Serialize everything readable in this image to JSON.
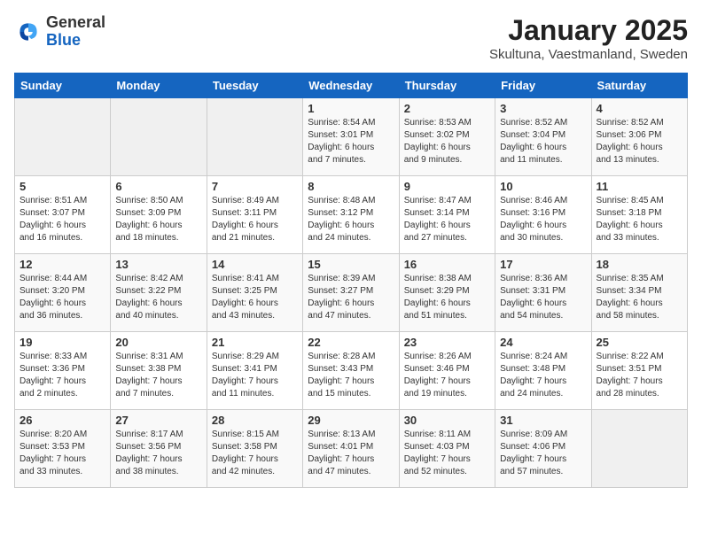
{
  "header": {
    "logo_line1": "General",
    "logo_line2": "Blue",
    "title": "January 2025",
    "subtitle": "Skultuna, Vaestmanland, Sweden"
  },
  "weekdays": [
    "Sunday",
    "Monday",
    "Tuesday",
    "Wednesday",
    "Thursday",
    "Friday",
    "Saturday"
  ],
  "weeks": [
    [
      {
        "day": "",
        "info": ""
      },
      {
        "day": "",
        "info": ""
      },
      {
        "day": "",
        "info": ""
      },
      {
        "day": "1",
        "info": "Sunrise: 8:54 AM\nSunset: 3:01 PM\nDaylight: 6 hours\nand 7 minutes."
      },
      {
        "day": "2",
        "info": "Sunrise: 8:53 AM\nSunset: 3:02 PM\nDaylight: 6 hours\nand 9 minutes."
      },
      {
        "day": "3",
        "info": "Sunrise: 8:52 AM\nSunset: 3:04 PM\nDaylight: 6 hours\nand 11 minutes."
      },
      {
        "day": "4",
        "info": "Sunrise: 8:52 AM\nSunset: 3:06 PM\nDaylight: 6 hours\nand 13 minutes."
      }
    ],
    [
      {
        "day": "5",
        "info": "Sunrise: 8:51 AM\nSunset: 3:07 PM\nDaylight: 6 hours\nand 16 minutes."
      },
      {
        "day": "6",
        "info": "Sunrise: 8:50 AM\nSunset: 3:09 PM\nDaylight: 6 hours\nand 18 minutes."
      },
      {
        "day": "7",
        "info": "Sunrise: 8:49 AM\nSunset: 3:11 PM\nDaylight: 6 hours\nand 21 minutes."
      },
      {
        "day": "8",
        "info": "Sunrise: 8:48 AM\nSunset: 3:12 PM\nDaylight: 6 hours\nand 24 minutes."
      },
      {
        "day": "9",
        "info": "Sunrise: 8:47 AM\nSunset: 3:14 PM\nDaylight: 6 hours\nand 27 minutes."
      },
      {
        "day": "10",
        "info": "Sunrise: 8:46 AM\nSunset: 3:16 PM\nDaylight: 6 hours\nand 30 minutes."
      },
      {
        "day": "11",
        "info": "Sunrise: 8:45 AM\nSunset: 3:18 PM\nDaylight: 6 hours\nand 33 minutes."
      }
    ],
    [
      {
        "day": "12",
        "info": "Sunrise: 8:44 AM\nSunset: 3:20 PM\nDaylight: 6 hours\nand 36 minutes."
      },
      {
        "day": "13",
        "info": "Sunrise: 8:42 AM\nSunset: 3:22 PM\nDaylight: 6 hours\nand 40 minutes."
      },
      {
        "day": "14",
        "info": "Sunrise: 8:41 AM\nSunset: 3:25 PM\nDaylight: 6 hours\nand 43 minutes."
      },
      {
        "day": "15",
        "info": "Sunrise: 8:39 AM\nSunset: 3:27 PM\nDaylight: 6 hours\nand 47 minutes."
      },
      {
        "day": "16",
        "info": "Sunrise: 8:38 AM\nSunset: 3:29 PM\nDaylight: 6 hours\nand 51 minutes."
      },
      {
        "day": "17",
        "info": "Sunrise: 8:36 AM\nSunset: 3:31 PM\nDaylight: 6 hours\nand 54 minutes."
      },
      {
        "day": "18",
        "info": "Sunrise: 8:35 AM\nSunset: 3:34 PM\nDaylight: 6 hours\nand 58 minutes."
      }
    ],
    [
      {
        "day": "19",
        "info": "Sunrise: 8:33 AM\nSunset: 3:36 PM\nDaylight: 7 hours\nand 2 minutes."
      },
      {
        "day": "20",
        "info": "Sunrise: 8:31 AM\nSunset: 3:38 PM\nDaylight: 7 hours\nand 7 minutes."
      },
      {
        "day": "21",
        "info": "Sunrise: 8:29 AM\nSunset: 3:41 PM\nDaylight: 7 hours\nand 11 minutes."
      },
      {
        "day": "22",
        "info": "Sunrise: 8:28 AM\nSunset: 3:43 PM\nDaylight: 7 hours\nand 15 minutes."
      },
      {
        "day": "23",
        "info": "Sunrise: 8:26 AM\nSunset: 3:46 PM\nDaylight: 7 hours\nand 19 minutes."
      },
      {
        "day": "24",
        "info": "Sunrise: 8:24 AM\nSunset: 3:48 PM\nDaylight: 7 hours\nand 24 minutes."
      },
      {
        "day": "25",
        "info": "Sunrise: 8:22 AM\nSunset: 3:51 PM\nDaylight: 7 hours\nand 28 minutes."
      }
    ],
    [
      {
        "day": "26",
        "info": "Sunrise: 8:20 AM\nSunset: 3:53 PM\nDaylight: 7 hours\nand 33 minutes."
      },
      {
        "day": "27",
        "info": "Sunrise: 8:17 AM\nSunset: 3:56 PM\nDaylight: 7 hours\nand 38 minutes."
      },
      {
        "day": "28",
        "info": "Sunrise: 8:15 AM\nSunset: 3:58 PM\nDaylight: 7 hours\nand 42 minutes."
      },
      {
        "day": "29",
        "info": "Sunrise: 8:13 AM\nSunset: 4:01 PM\nDaylight: 7 hours\nand 47 minutes."
      },
      {
        "day": "30",
        "info": "Sunrise: 8:11 AM\nSunset: 4:03 PM\nDaylight: 7 hours\nand 52 minutes."
      },
      {
        "day": "31",
        "info": "Sunrise: 8:09 AM\nSunset: 4:06 PM\nDaylight: 7 hours\nand 57 minutes."
      },
      {
        "day": "",
        "info": ""
      }
    ]
  ]
}
